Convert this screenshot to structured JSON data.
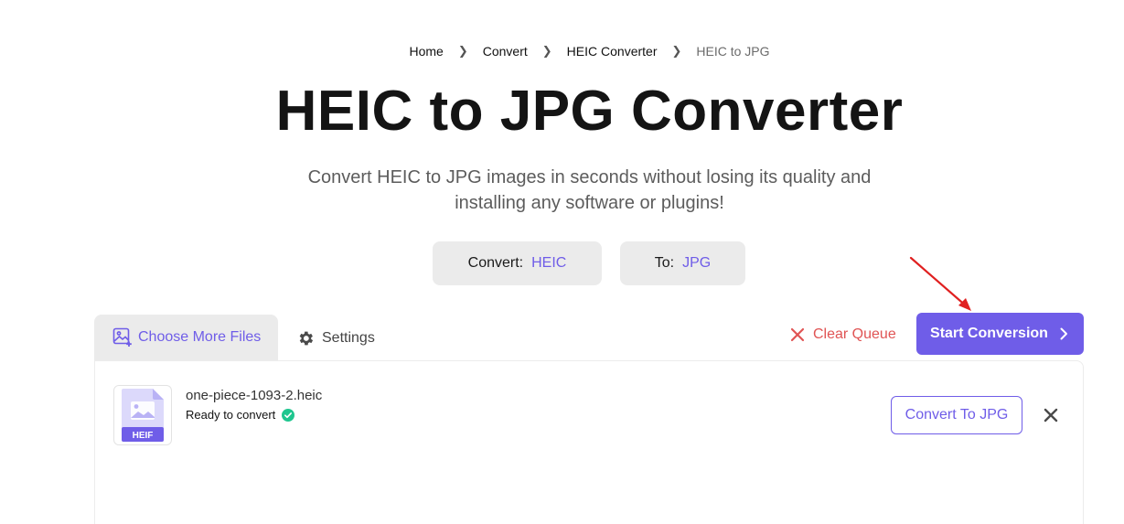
{
  "breadcrumb": {
    "items": [
      "Home",
      "Convert",
      "HEIC Converter"
    ],
    "current": "HEIC to JPG"
  },
  "page": {
    "title": "HEIC to JPG Converter",
    "subtitle_line1": "Convert HEIC to JPG images in seconds without losing its quality and",
    "subtitle_line2": "installing any software or plugins!"
  },
  "format": {
    "from_label": "Convert:",
    "from_value": "HEIC",
    "to_label": "To:",
    "to_value": "JPG"
  },
  "toolbar": {
    "choose_label": "Choose More Files",
    "settings_label": "Settings",
    "clear_label": "Clear Queue",
    "start_label": "Start Conversion"
  },
  "file": {
    "name": "one-piece-1093-2.heic",
    "status": "Ready to convert",
    "badge": "HEIF",
    "convert_label": "Convert To JPG"
  },
  "colors": {
    "accent": "#6f5de8",
    "danger": "#e05454",
    "success": "#1fc68f",
    "annotation_arrow": "#e02020"
  }
}
